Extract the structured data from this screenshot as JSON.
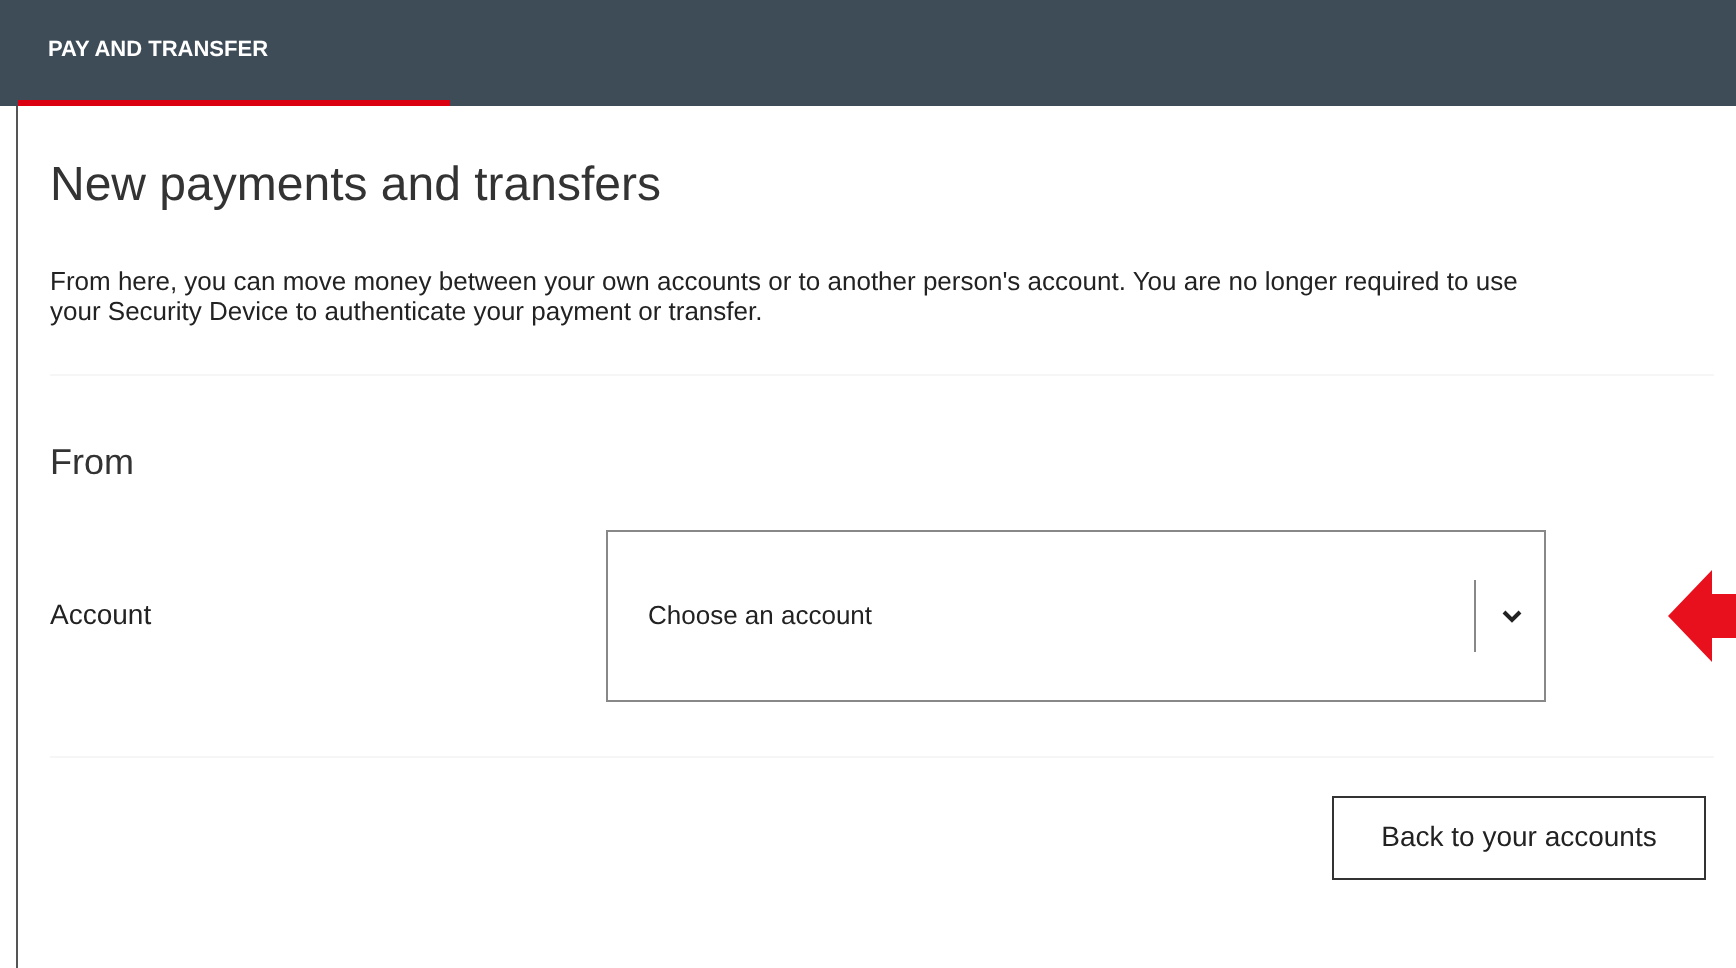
{
  "header": {
    "tabs": [
      {
        "label": "PAY AND TRANSFER",
        "selected": true
      }
    ]
  },
  "title": "New payments and transfers",
  "intro": "From here, you can move money between your own accounts or to another person's account. You are no longer required to use your Security Device to authenticate your payment or transfer.",
  "section": {
    "heading": "From",
    "fields": [
      {
        "label": "Account",
        "placeholder": "Choose an account"
      }
    ]
  },
  "buttons": [
    "Back to your accounts"
  ]
}
